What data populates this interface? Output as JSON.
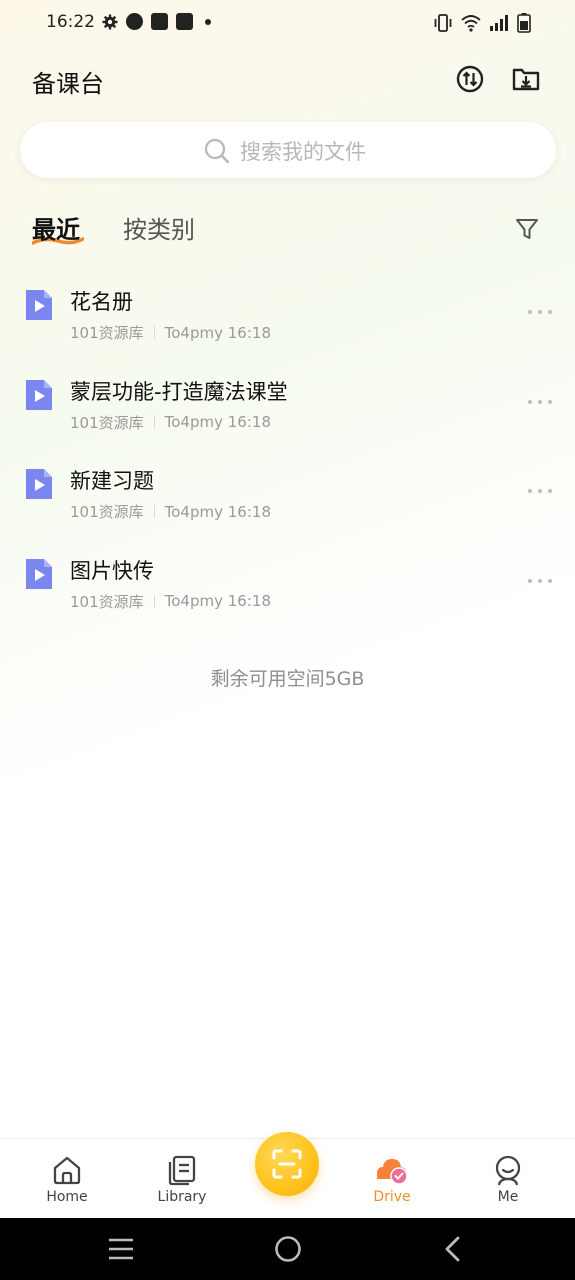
{
  "status_bar": {
    "time": "16:22",
    "icons_left": [
      "gear-icon",
      "circle-app-icon",
      "bag-icon",
      "bag-icon",
      "dot-icon"
    ],
    "icons_right": [
      "vibrate-icon",
      "wifi-icon",
      "signal-icon",
      "battery-icon"
    ]
  },
  "header": {
    "title": "备课台",
    "actions": [
      "sync-icon",
      "folder-download-icon"
    ]
  },
  "search": {
    "placeholder": "搜索我的文件"
  },
  "tabs": {
    "recent": "最近",
    "by_category": "按类别",
    "active": "recent",
    "accent_color": "#f08a2c"
  },
  "files": [
    {
      "name": "花名册",
      "source": "101资源库",
      "owner_time": "To4pmy 16:18"
    },
    {
      "name": "蒙层功能-打造魔法课堂",
      "source": "101资源库",
      "owner_time": "To4pmy 16:18"
    },
    {
      "name": "新建习题",
      "source": "101资源库",
      "owner_time": "To4pmy 16:18"
    },
    {
      "name": "图片快传",
      "source": "101资源库",
      "owner_time": "To4pmy 16:18"
    }
  ],
  "file_icon_color": "#7b86f0",
  "storage_note": "剩余可用空间5GB",
  "bottom_nav": {
    "home": "Home",
    "library": "Library",
    "drive": "Drive",
    "me": "Me",
    "active": "drive",
    "scan_color": "#ffc21c"
  }
}
